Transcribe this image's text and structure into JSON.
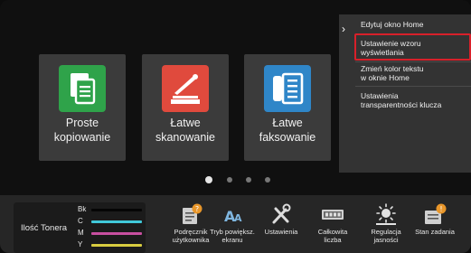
{
  "tiles": [
    {
      "label": "Proste kopiowanie",
      "line1": "Proste",
      "line2": "kopiowanie",
      "icon": "copy-icon",
      "color": "#2fa34a"
    },
    {
      "label": "Łatwe skanowanie",
      "line1": "Łatwe",
      "line2": "skanowanie",
      "icon": "scan-icon",
      "color": "#e04a3d"
    },
    {
      "label": "Łatwe faksowanie",
      "line1": "Łatwe",
      "line2": "faksowanie",
      "icon": "fax-icon",
      "color": "#2f86c8"
    }
  ],
  "page_indicator": {
    "pages": 4,
    "current": 1
  },
  "toner": {
    "title": "Ilość Tonera",
    "levels": [
      {
        "name": "Bk",
        "color": "#000000",
        "level": 1.0
      },
      {
        "name": "C",
        "color": "#40c8d8",
        "level": 1.0
      },
      {
        "name": "M",
        "color": "#c84fa0",
        "level": 1.0
      },
      {
        "name": "Y",
        "color": "#d8cc40",
        "level": 1.0
      }
    ]
  },
  "bottom_items": [
    {
      "line1": "Podręcznik",
      "line2": "użytkownika",
      "icon": "user-manual-icon"
    },
    {
      "line1": "Tryb powiększ.",
      "line2": "ekranu",
      "icon": "text-enlarge-icon"
    },
    {
      "line1": "Ustawienia",
      "line2": "",
      "icon": "settings-tools-icon"
    },
    {
      "line1": "Całkowita",
      "line2": "liczba",
      "icon": "total-count-icon"
    },
    {
      "line1": "Regulacja",
      "line2": "jasności",
      "icon": "brightness-icon"
    },
    {
      "line1": "Stan zadania",
      "line2": "",
      "icon": "job-status-icon"
    }
  ],
  "menu": {
    "items": [
      {
        "line1": "Edytuj okno Home",
        "line2": ""
      },
      {
        "line1": "Ustawienie wzoru",
        "line2": "wyświetlania"
      },
      {
        "line1": "Zmień kolor tekstu",
        "line2": "w oknie Home"
      },
      {
        "line1": "Ustawienia",
        "line2": "transparentności klucza"
      }
    ],
    "selected": 1,
    "highlight_color": "#d8202a"
  }
}
